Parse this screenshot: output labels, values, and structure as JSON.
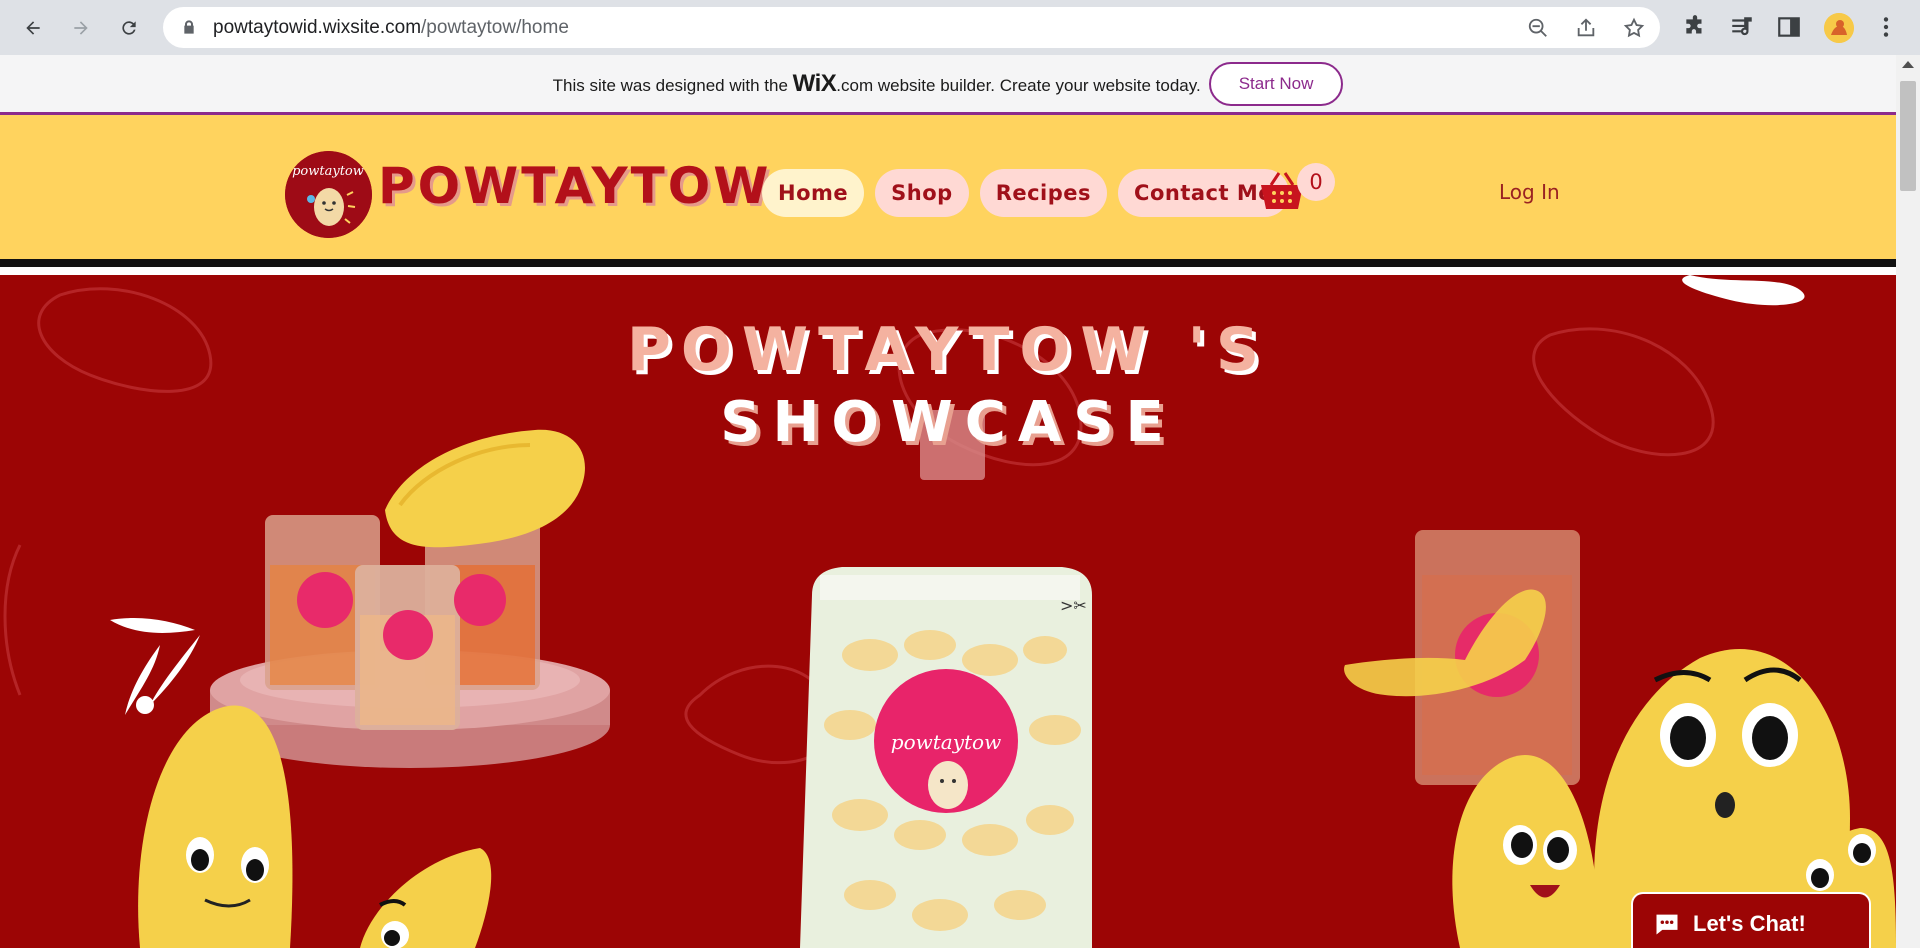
{
  "browser": {
    "url_domain": "powtaytowid.wixsite.com",
    "url_path": "/powtaytow/home"
  },
  "wix_banner": {
    "text_before": "This site was designed with the ",
    "wix_logo": "WiX",
    "wix_dotcom": ".com",
    "text_after": " website builder. Create your website today.",
    "start_button": "Start Now"
  },
  "header": {
    "brand": "POWTAYTOW",
    "nav": [
      {
        "label": "Home",
        "active": true
      },
      {
        "label": "Shop",
        "active": false
      },
      {
        "label": "Recipes",
        "active": false
      },
      {
        "label": "Contact Me",
        "active": false
      }
    ],
    "cart_count": "0",
    "login_label": "Log In"
  },
  "hero": {
    "title_line1": "POWTAYTOW 'S",
    "title_line2": "SHOWCASE",
    "bag_label": "powtaytow"
  },
  "chat": {
    "label": "Let's Chat!"
  },
  "colors": {
    "header_bg": "#ffd35e",
    "hero_bg": "#9c0505",
    "brand_red": "#b3101a",
    "nav_pill": "#ffd9d4",
    "wix_accent": "#8c2a8c"
  }
}
